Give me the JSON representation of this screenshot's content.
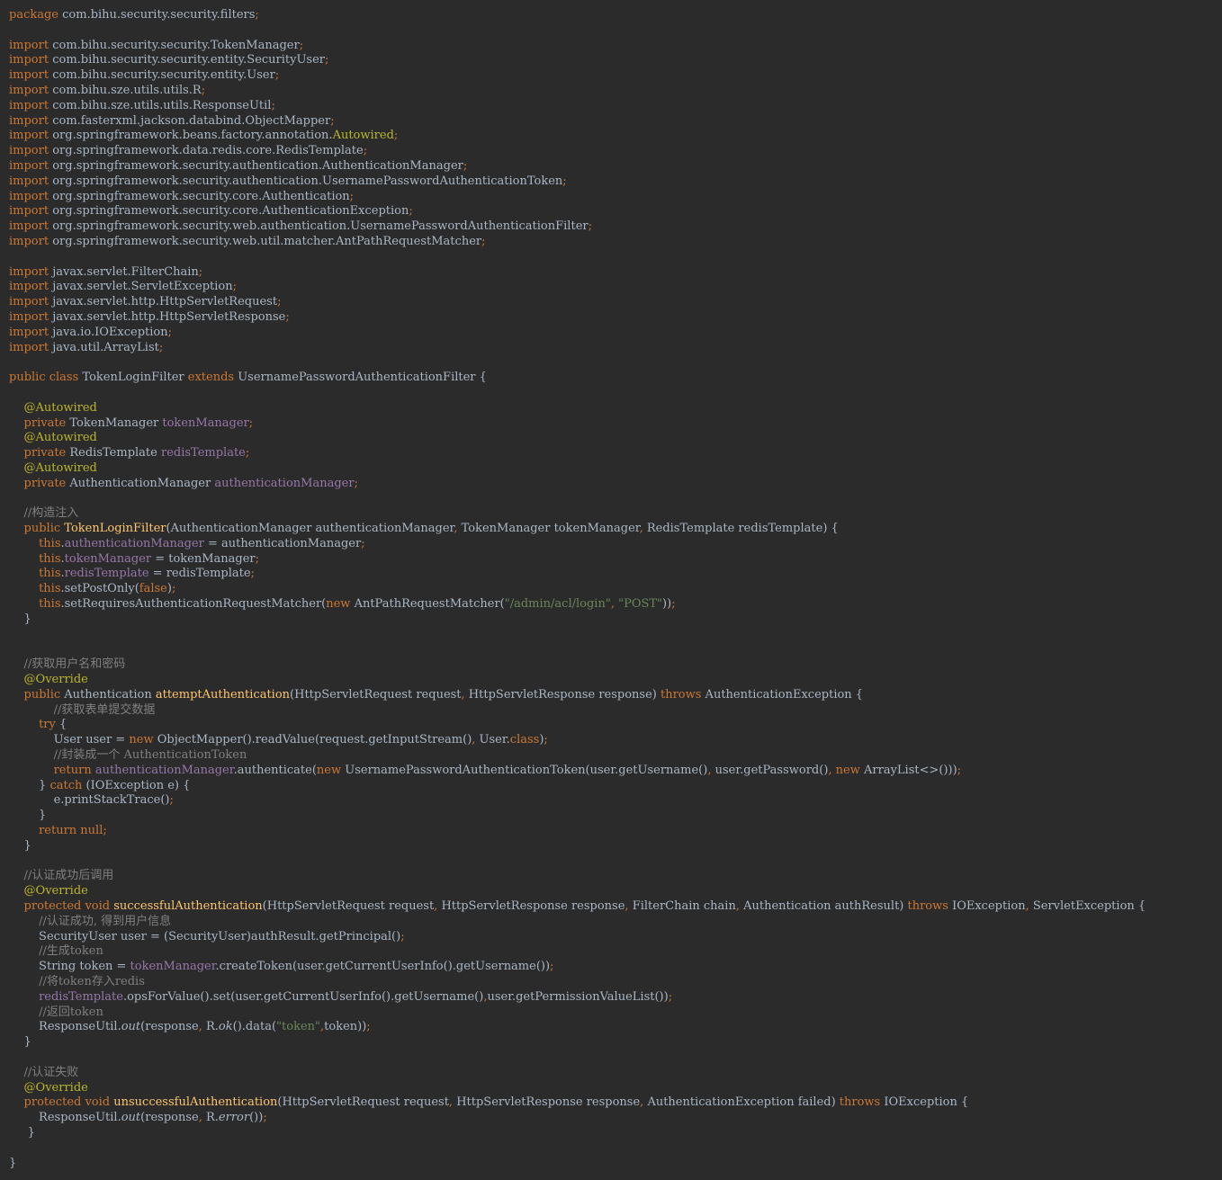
{
  "editor": {
    "language": "java",
    "theme_colors": {
      "background": "#2b2b2b",
      "plain": "#a9b7c6",
      "keyword": "#cc7832",
      "annotation": "#bbb529",
      "field": "#9876aa",
      "method_declaration": "#ffc66d",
      "string": "#6a8759",
      "comment": "#808080"
    },
    "lines": [
      [
        [
          "kw",
          "package"
        ],
        [
          "pl",
          " com.bihu.security.security.filters"
        ],
        [
          "kw",
          ";"
        ]
      ],
      [],
      [
        [
          "kw",
          "import"
        ],
        [
          "pl",
          " com.bihu.security.security.TokenManager"
        ],
        [
          "kw",
          ";"
        ]
      ],
      [
        [
          "kw",
          "import"
        ],
        [
          "pl",
          " com.bihu.security.security.entity.SecurityUser"
        ],
        [
          "kw",
          ";"
        ]
      ],
      [
        [
          "kw",
          "import"
        ],
        [
          "pl",
          " com.bihu.security.security.entity.User"
        ],
        [
          "kw",
          ";"
        ]
      ],
      [
        [
          "kw",
          "import"
        ],
        [
          "pl",
          " com.bihu.sze.utils.utils.R"
        ],
        [
          "kw",
          ";"
        ]
      ],
      [
        [
          "kw",
          "import"
        ],
        [
          "pl",
          " com.bihu.sze.utils.utils.ResponseUtil"
        ],
        [
          "kw",
          ";"
        ]
      ],
      [
        [
          "kw",
          "import"
        ],
        [
          "pl",
          " com.fasterxml.jackson.databind.ObjectMapper"
        ],
        [
          "kw",
          ";"
        ]
      ],
      [
        [
          "kw",
          "import"
        ],
        [
          "pl",
          " org.springframework.beans.factory.annotation."
        ],
        [
          "an",
          "Autowired"
        ],
        [
          "kw",
          ";"
        ]
      ],
      [
        [
          "kw",
          "import"
        ],
        [
          "pl",
          " org.springframework.data.redis.core.RedisTemplate"
        ],
        [
          "kw",
          ";"
        ]
      ],
      [
        [
          "kw",
          "import"
        ],
        [
          "pl",
          " org.springframework.security.authentication.AuthenticationManager"
        ],
        [
          "kw",
          ";"
        ]
      ],
      [
        [
          "kw",
          "import"
        ],
        [
          "pl",
          " org.springframework.security.authentication.UsernamePasswordAuthenticationToken"
        ],
        [
          "kw",
          ";"
        ]
      ],
      [
        [
          "kw",
          "import"
        ],
        [
          "pl",
          " org.springframework.security.core.Authentication"
        ],
        [
          "kw",
          ";"
        ]
      ],
      [
        [
          "kw",
          "import"
        ],
        [
          "pl",
          " org.springframework.security.core.AuthenticationException"
        ],
        [
          "kw",
          ";"
        ]
      ],
      [
        [
          "kw",
          "import"
        ],
        [
          "pl",
          " org.springframework.security.web.authentication.UsernamePasswordAuthenticationFilter"
        ],
        [
          "kw",
          ";"
        ]
      ],
      [
        [
          "kw",
          "import"
        ],
        [
          "pl",
          " org.springframework.security.web.util.matcher.AntPathRequestMatcher"
        ],
        [
          "kw",
          ";"
        ]
      ],
      [],
      [
        [
          "kw",
          "import"
        ],
        [
          "pl",
          " javax.servlet.FilterChain"
        ],
        [
          "kw",
          ";"
        ]
      ],
      [
        [
          "kw",
          "import"
        ],
        [
          "pl",
          " javax.servlet.ServletException"
        ],
        [
          "kw",
          ";"
        ]
      ],
      [
        [
          "kw",
          "import"
        ],
        [
          "pl",
          " javax.servlet.http.HttpServletRequest"
        ],
        [
          "kw",
          ";"
        ]
      ],
      [
        [
          "kw",
          "import"
        ],
        [
          "pl",
          " javax.servlet.http.HttpServletResponse"
        ],
        [
          "kw",
          ";"
        ]
      ],
      [
        [
          "kw",
          "import"
        ],
        [
          "pl",
          " java.io.IOException"
        ],
        [
          "kw",
          ";"
        ]
      ],
      [
        [
          "kw",
          "import"
        ],
        [
          "pl",
          " java.util.ArrayList"
        ],
        [
          "kw",
          ";"
        ]
      ],
      [],
      [
        [
          "kw",
          "public class"
        ],
        [
          "pl",
          " TokenLoginFilter "
        ],
        [
          "kw",
          "extends"
        ],
        [
          "pl",
          " UsernamePasswordAuthenticationFilter {"
        ]
      ],
      [],
      [
        [
          "pl",
          "    "
        ],
        [
          "an",
          "@Autowired"
        ]
      ],
      [
        [
          "pl",
          "    "
        ],
        [
          "kw",
          "private"
        ],
        [
          "pl",
          " TokenManager "
        ],
        [
          "fd",
          "tokenManager"
        ],
        [
          "kw",
          ";"
        ]
      ],
      [
        [
          "pl",
          "    "
        ],
        [
          "an",
          "@Autowired"
        ]
      ],
      [
        [
          "pl",
          "    "
        ],
        [
          "kw",
          "private"
        ],
        [
          "pl",
          " RedisTemplate "
        ],
        [
          "fd",
          "redisTemplate"
        ],
        [
          "kw",
          ";"
        ]
      ],
      [
        [
          "pl",
          "    "
        ],
        [
          "an",
          "@Autowired"
        ]
      ],
      [
        [
          "pl",
          "    "
        ],
        [
          "kw",
          "private"
        ],
        [
          "pl",
          " AuthenticationManager "
        ],
        [
          "fd",
          "authenticationManager"
        ],
        [
          "kw",
          ";"
        ]
      ],
      [],
      [
        [
          "pl",
          "    "
        ],
        [
          "cm",
          "//构造注入"
        ]
      ],
      [
        [
          "pl",
          "    "
        ],
        [
          "kw",
          "public"
        ],
        [
          "pl",
          " "
        ],
        [
          "mt",
          "TokenLoginFilter"
        ],
        [
          "pl",
          "(AuthenticationManager authenticationManager"
        ],
        [
          "kw",
          ","
        ],
        [
          "pl",
          " TokenManager tokenManager"
        ],
        [
          "kw",
          ","
        ],
        [
          "pl",
          " RedisTemplate redisTemplate) {"
        ]
      ],
      [
        [
          "pl",
          "        "
        ],
        [
          "kw",
          "this"
        ],
        [
          "pl",
          "."
        ],
        [
          "fd",
          "authenticationManager"
        ],
        [
          "pl",
          " = authenticationManager"
        ],
        [
          "kw",
          ";"
        ]
      ],
      [
        [
          "pl",
          "        "
        ],
        [
          "kw",
          "this"
        ],
        [
          "pl",
          "."
        ],
        [
          "fd",
          "tokenManager"
        ],
        [
          "pl",
          " = tokenManager"
        ],
        [
          "kw",
          ";"
        ]
      ],
      [
        [
          "pl",
          "        "
        ],
        [
          "kw",
          "this"
        ],
        [
          "pl",
          "."
        ],
        [
          "fd",
          "redisTemplate"
        ],
        [
          "pl",
          " = redisTemplate"
        ],
        [
          "kw",
          ";"
        ]
      ],
      [
        [
          "pl",
          "        "
        ],
        [
          "kw",
          "this"
        ],
        [
          "pl",
          ".setPostOnly("
        ],
        [
          "kw",
          "false"
        ],
        [
          "pl",
          ")"
        ],
        [
          "kw",
          ";"
        ]
      ],
      [
        [
          "pl",
          "        "
        ],
        [
          "kw",
          "this"
        ],
        [
          "pl",
          ".setRequiresAuthenticationRequestMatcher("
        ],
        [
          "kw",
          "new"
        ],
        [
          "pl",
          " AntPathRequestMatcher("
        ],
        [
          "st",
          "\"/admin/acl/login\""
        ],
        [
          "kw",
          ","
        ],
        [
          "pl",
          " "
        ],
        [
          "st",
          "\"POST\""
        ],
        [
          "pl",
          "))"
        ],
        [
          "kw",
          ";"
        ]
      ],
      [
        [
          "pl",
          "    }"
        ]
      ],
      [],
      [],
      [
        [
          "pl",
          "    "
        ],
        [
          "cm",
          "//获取用户名和密码"
        ]
      ],
      [
        [
          "pl",
          "    "
        ],
        [
          "an",
          "@Override"
        ]
      ],
      [
        [
          "pl",
          "    "
        ],
        [
          "kw",
          "public"
        ],
        [
          "pl",
          " Authentication "
        ],
        [
          "mt",
          "attemptAuthentication"
        ],
        [
          "pl",
          "(HttpServletRequest request"
        ],
        [
          "kw",
          ","
        ],
        [
          "pl",
          " HttpServletResponse response) "
        ],
        [
          "kw",
          "throws"
        ],
        [
          "pl",
          " AuthenticationException {"
        ]
      ],
      [
        [
          "pl",
          "            "
        ],
        [
          "cm",
          "//获取表单提交数据"
        ]
      ],
      [
        [
          "pl",
          "        "
        ],
        [
          "kw",
          "try"
        ],
        [
          "pl",
          " {"
        ]
      ],
      [
        [
          "pl",
          "            User user = "
        ],
        [
          "kw",
          "new"
        ],
        [
          "pl",
          " ObjectMapper().readValue(request.getInputStream()"
        ],
        [
          "kw",
          ","
        ],
        [
          "pl",
          " User."
        ],
        [
          "kw",
          "class"
        ],
        [
          "pl",
          ")"
        ],
        [
          "kw",
          ";"
        ]
      ],
      [
        [
          "pl",
          "            "
        ],
        [
          "cm",
          "//封装成一个 AuthenticationToken"
        ]
      ],
      [
        [
          "pl",
          "            "
        ],
        [
          "kw",
          "return"
        ],
        [
          "pl",
          " "
        ],
        [
          "fd",
          "authenticationManager"
        ],
        [
          "pl",
          ".authenticate("
        ],
        [
          "kw",
          "new"
        ],
        [
          "pl",
          " UsernamePasswordAuthenticationToken(user.getUsername()"
        ],
        [
          "kw",
          ","
        ],
        [
          "pl",
          " user.getPassword()"
        ],
        [
          "kw",
          ","
        ],
        [
          "pl",
          " "
        ],
        [
          "kw",
          "new"
        ],
        [
          "pl",
          " ArrayList<>()))"
        ],
        [
          "kw",
          ";"
        ]
      ],
      [
        [
          "pl",
          "        } "
        ],
        [
          "kw",
          "catch"
        ],
        [
          "pl",
          " (IOException e) {"
        ]
      ],
      [
        [
          "pl",
          "            e.printStackTrace()"
        ],
        [
          "kw",
          ";"
        ]
      ],
      [
        [
          "pl",
          "        }"
        ]
      ],
      [
        [
          "pl",
          "        "
        ],
        [
          "kw",
          "return null"
        ],
        [
          "kw",
          ";"
        ]
      ],
      [
        [
          "pl",
          "    }"
        ]
      ],
      [],
      [
        [
          "pl",
          "    "
        ],
        [
          "cm",
          "//认证成功后调用"
        ]
      ],
      [
        [
          "pl",
          "    "
        ],
        [
          "an",
          "@Override"
        ]
      ],
      [
        [
          "pl",
          "    "
        ],
        [
          "kw",
          "protected void"
        ],
        [
          "pl",
          " "
        ],
        [
          "mt",
          "successfulAuthentication"
        ],
        [
          "pl",
          "(HttpServletRequest request"
        ],
        [
          "kw",
          ","
        ],
        [
          "pl",
          " HttpServletResponse response"
        ],
        [
          "kw",
          ","
        ],
        [
          "pl",
          " FilterChain chain"
        ],
        [
          "kw",
          ","
        ],
        [
          "pl",
          " Authentication authResult) "
        ],
        [
          "kw",
          "throws"
        ],
        [
          "pl",
          " IOException"
        ],
        [
          "kw",
          ","
        ],
        [
          "pl",
          " ServletException {"
        ]
      ],
      [
        [
          "pl",
          "        "
        ],
        [
          "cm",
          "//认证成功, 得到用户信息"
        ]
      ],
      [
        [
          "pl",
          "        SecurityUser user = (SecurityUser)authResult.getPrincipal()"
        ],
        [
          "kw",
          ";"
        ]
      ],
      [
        [
          "pl",
          "        "
        ],
        [
          "cm",
          "//生成token"
        ]
      ],
      [
        [
          "pl",
          "        String token = "
        ],
        [
          "fd",
          "tokenManager"
        ],
        [
          "pl",
          ".createToken(user.getCurrentUserInfo().getUsername())"
        ],
        [
          "kw",
          ";"
        ]
      ],
      [
        [
          "pl",
          "        "
        ],
        [
          "cm",
          "//将token存入redis"
        ]
      ],
      [
        [
          "pl",
          "        "
        ],
        [
          "fd",
          "redisTemplate"
        ],
        [
          "pl",
          ".opsForValue().set(user.getCurrentUserInfo().getUsername()"
        ],
        [
          "kw",
          ","
        ],
        [
          "pl",
          "user.getPermissionValueList())"
        ],
        [
          "kw",
          ";"
        ]
      ],
      [
        [
          "pl",
          "        "
        ],
        [
          "cm",
          "//返回token"
        ]
      ],
      [
        [
          "pl",
          "        ResponseUtil."
        ],
        [
          "it",
          "out"
        ],
        [
          "pl",
          "(response"
        ],
        [
          "kw",
          ","
        ],
        [
          "pl",
          " R."
        ],
        [
          "it",
          "ok"
        ],
        [
          "pl",
          "().data("
        ],
        [
          "st",
          "\"token\""
        ],
        [
          "kw",
          ","
        ],
        [
          "pl",
          "token))"
        ],
        [
          "kw",
          ";"
        ]
      ],
      [
        [
          "pl",
          "    }"
        ]
      ],
      [],
      [
        [
          "pl",
          "    "
        ],
        [
          "cm",
          "//认证失败"
        ]
      ],
      [
        [
          "pl",
          "    "
        ],
        [
          "an",
          "@Override"
        ]
      ],
      [
        [
          "pl",
          "    "
        ],
        [
          "kw",
          "protected void"
        ],
        [
          "pl",
          " "
        ],
        [
          "mt",
          "unsuccessfulAuthentication"
        ],
        [
          "pl",
          "(HttpServletRequest request"
        ],
        [
          "kw",
          ","
        ],
        [
          "pl",
          " HttpServletResponse response"
        ],
        [
          "kw",
          ","
        ],
        [
          "pl",
          " AuthenticationException failed) "
        ],
        [
          "kw",
          "throws"
        ],
        [
          "pl",
          " IOException {"
        ]
      ],
      [
        [
          "pl",
          "        ResponseUtil."
        ],
        [
          "it",
          "out"
        ],
        [
          "pl",
          "(response"
        ],
        [
          "kw",
          ","
        ],
        [
          "pl",
          " R."
        ],
        [
          "it",
          "error"
        ],
        [
          "pl",
          "())"
        ],
        [
          "kw",
          ";"
        ]
      ],
      [
        [
          "pl",
          "     }"
        ]
      ],
      [],
      [
        [
          "pl",
          "}"
        ]
      ]
    ]
  }
}
